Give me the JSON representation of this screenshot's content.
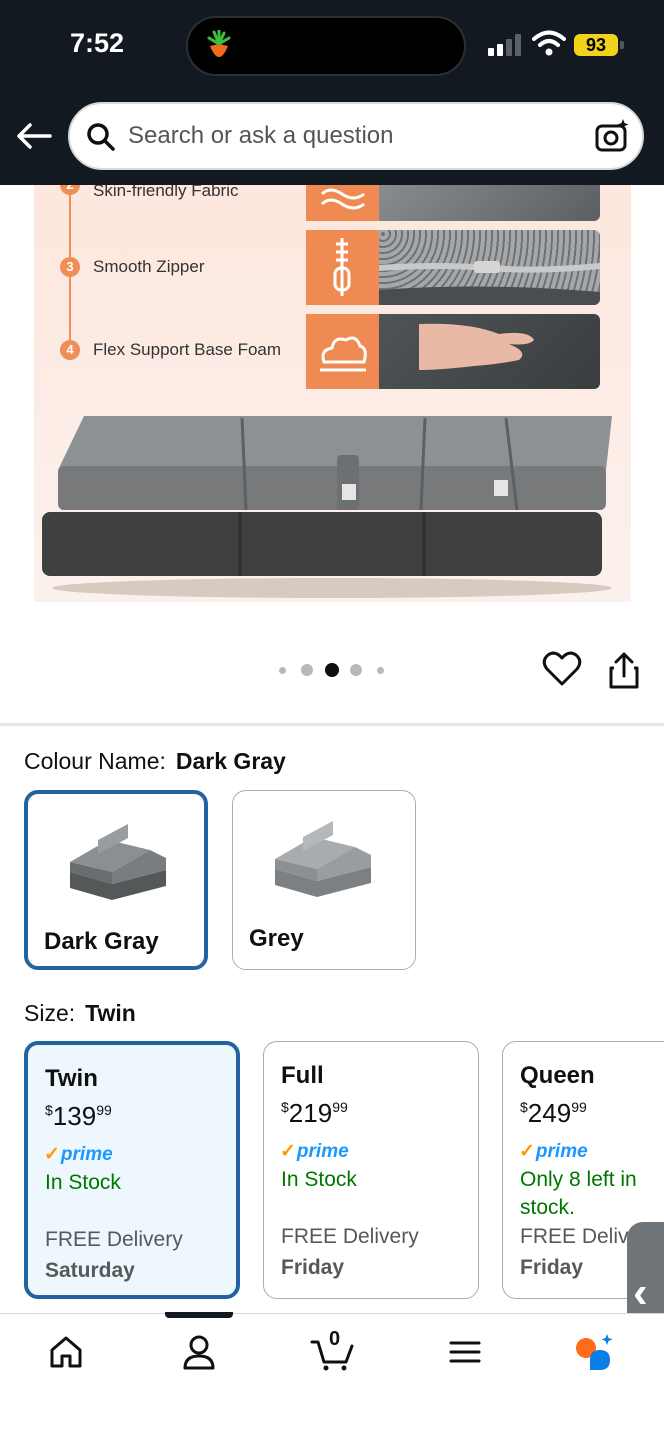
{
  "status_bar": {
    "time": "7:52",
    "battery": "93"
  },
  "search": {
    "placeholder": "Search or ask a question"
  },
  "hero_features": [
    {
      "num": "2",
      "label": "Skin-friendly Fabric"
    },
    {
      "num": "3",
      "label": "Smooth Zipper"
    },
    {
      "num": "4",
      "label": "Flex Support Base Foam"
    }
  ],
  "carousel": {
    "count": 5,
    "active_index": 2
  },
  "colour": {
    "label": "Colour Name:",
    "selected": "Dark Gray",
    "options": [
      {
        "label": "Dark Gray"
      },
      {
        "label": "Grey"
      }
    ]
  },
  "size": {
    "label": "Size:",
    "selected": "Twin",
    "options": [
      {
        "name": "Twin",
        "currency": "$",
        "dollars": "139",
        "cents": "99",
        "prime": "prime",
        "stock": "In Stock",
        "delivery": "FREE Delivery",
        "day": "Saturday"
      },
      {
        "name": "Full",
        "currency": "$",
        "dollars": "219",
        "cents": "99",
        "prime": "prime",
        "stock": "In Stock",
        "delivery": "FREE Delivery",
        "day": "Friday"
      },
      {
        "name": "Queen",
        "currency": "$",
        "dollars": "249",
        "cents": "99",
        "prime": "prime",
        "stock": "Only 8 left in stock.",
        "delivery": "FREE Delivery",
        "day": "Friday"
      }
    ]
  },
  "bottom_nav": {
    "cart_count": "0"
  },
  "colors": {
    "header_bg": "#131921",
    "selected_border": "#2162a1",
    "in_stock": "#007600",
    "prime_blue": "#1a98ff",
    "accent_orange": "#ef8a52"
  }
}
